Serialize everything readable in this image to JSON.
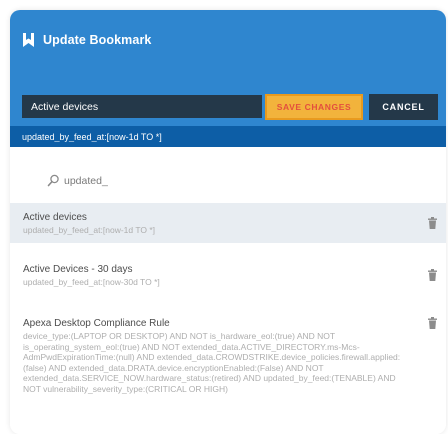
{
  "dialog": {
    "title": "Update Bookmark"
  },
  "form": {
    "name_value": "Active devices",
    "save_label": "SAVE CHANGES",
    "cancel_label": "CANCEL",
    "query_value": "updated_by_feed_at:[now-1d TO *]"
  },
  "search": {
    "value": "updated_"
  },
  "bookmarks": [
    {
      "name": "Active devices",
      "query": "updated_by_feed_at:[now-1d TO *]"
    },
    {
      "name": "Active Devices - 30 days",
      "query": "updated_by_feed_at:[now-30d TO *]"
    },
    {
      "name": "Apexa Desktop Compliance Rule",
      "query": "device_type:(LAPTOP OR DESKTOP) AND NOT is_hardware_eol:(true) AND NOT is_operating_system_eol:(true) AND NOT extended_data.ACTIVE_DIRECTORY.ms-Mcs-AdmPwdExpirationTime:(null) AND extended_data.CROWDSTRIKE.device_policies.firewall.applied:(false) AND extended_data.DRATA.device.encryptionEnabled:(False) AND NOT extended_data.SERVICE_NOW.hardware_status:(retired) AND updated_by_feed:(TENABLE) AND NOT vulnerability_severity_type:(CRITICAL OR HIGH)"
    }
  ],
  "colors": {
    "header": "#2f86cf",
    "query_bar": "#0d5ea6",
    "input_dark": "#243849",
    "save_fill": "#f2b33c",
    "save_text": "#e34f3e",
    "selected_row": "#e8edf2"
  },
  "icons": {
    "title": "bookmark-icon",
    "search": "search-icon",
    "delete": "trash-icon"
  }
}
